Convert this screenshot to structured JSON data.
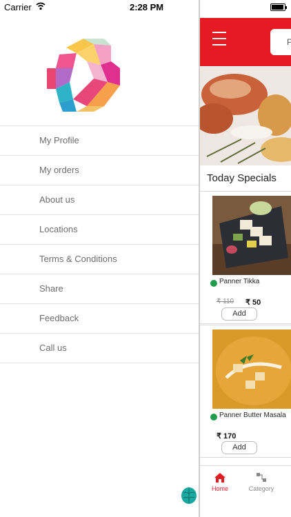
{
  "status_bar": {
    "carrier": "Carrier",
    "time": "2:28 PM"
  },
  "drawer": {
    "menu_items": [
      {
        "label": "My Profile"
      },
      {
        "label": "My orders"
      },
      {
        "label": "About us"
      },
      {
        "label": "Locations"
      },
      {
        "label": "Terms & Conditions"
      },
      {
        "label": "Share"
      },
      {
        "label": "Feedback"
      },
      {
        "label": "Call us"
      }
    ]
  },
  "main": {
    "search_placeholder": "P",
    "section_title": "Today Specials",
    "dishes": [
      {
        "name": "Panner Tikka",
        "mrp": "₹ 110",
        "price": "₹ 50",
        "add_label": "Add"
      },
      {
        "name": "Panner Butter Masala",
        "mrp": "",
        "price": "₹ 170",
        "add_label": "Add"
      }
    ],
    "tabs": [
      {
        "label": "Home",
        "icon": "home-icon",
        "active": true
      },
      {
        "label": "Category",
        "icon": "category-icon",
        "active": false
      }
    ]
  },
  "colors": {
    "accent": "#e41b23",
    "veg": "#1f9d4b"
  }
}
